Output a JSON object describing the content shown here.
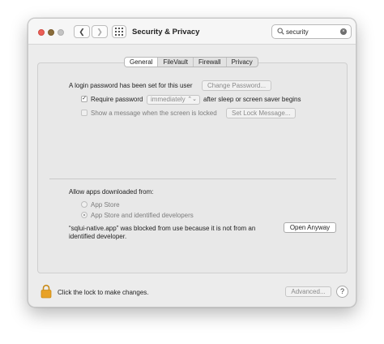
{
  "window": {
    "title": "Security & Privacy",
    "back_glyph": "❮",
    "forward_glyph": "❯"
  },
  "search": {
    "value": "security",
    "clear_glyph": "×"
  },
  "tabs": [
    {
      "label": "General",
      "active": true
    },
    {
      "label": "FileVault",
      "active": false
    },
    {
      "label": "Firewall",
      "active": false
    },
    {
      "label": "Privacy",
      "active": false
    }
  ],
  "general": {
    "login_text": "A login password has been set for this user",
    "change_password_label": "Change Password...",
    "require_password_label": "Require password",
    "require_password_checked": true,
    "require_password_check_glyph": "✓",
    "require_password_value": "immediately",
    "select_arrows_glyph": "⌃⌄",
    "after_sleep_text": "after sleep or screen saver begins",
    "show_message_label": "Show a message when the screen is locked",
    "show_message_checked": false,
    "set_lock_message_label": "Set Lock Message...",
    "allow_apps_heading": "Allow apps downloaded from:",
    "app_store_option": "App Store",
    "app_store_identified_option": "App Store and identified developers",
    "selected_option": "App Store and identified developers",
    "blocked_line1": "“sqlui-native.app” was blocked from use because it is not from an",
    "blocked_line2": "identified developer.",
    "open_anyway_label": "Open Anyway"
  },
  "footer": {
    "lock_text": "Click the lock to make changes.",
    "advanced_label": "Advanced...",
    "help_label": "?"
  },
  "colors": {
    "close": "#ec5f57",
    "minimize": "#8a6d3b",
    "zoom_disabled": "#c4c4c4",
    "lock": "#e8a227"
  }
}
